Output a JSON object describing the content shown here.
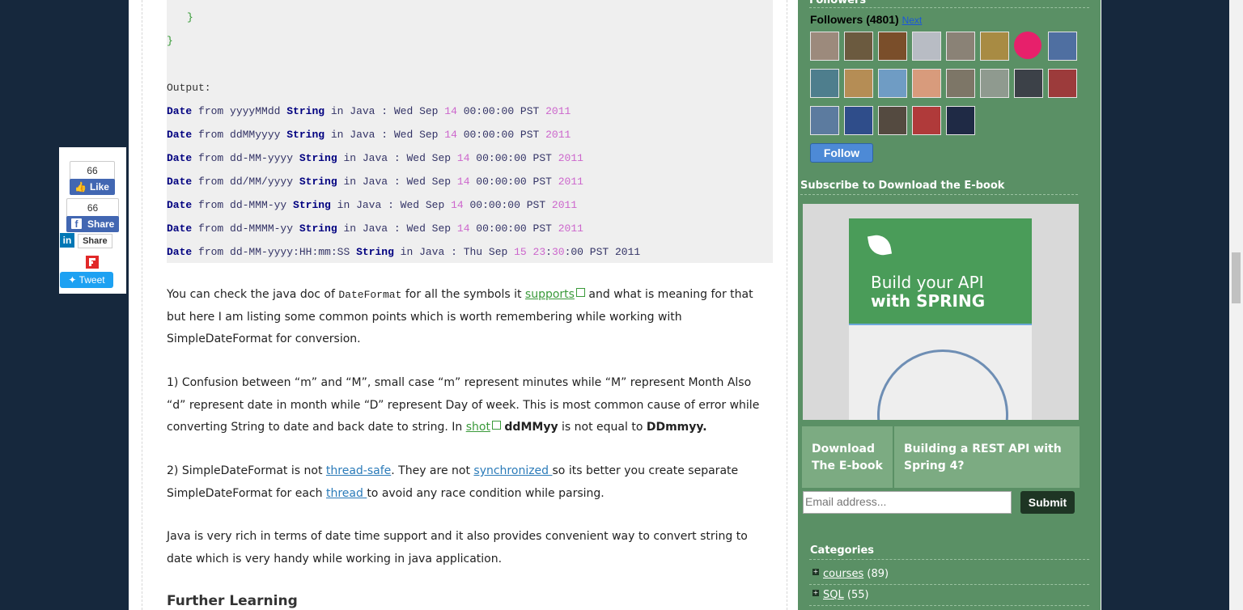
{
  "code": {
    "brace_inner": "}",
    "brace_outer": "}",
    "output_label": "Output:",
    "lines": [
      {
        "kw1": "Date",
        "t1": " from yyyyMMdd ",
        "kw2": "String",
        "t2": " in Java : Wed Sep ",
        "n1": "14",
        "t3": " 00:00:00 PST ",
        "n2": "2011",
        "t4": "",
        "n3": "",
        "t5": ""
      },
      {
        "kw1": "Date",
        "t1": " from ddMMyyyy ",
        "kw2": "String",
        "t2": " in Java : Wed Sep ",
        "n1": "14",
        "t3": " 00:00:00 PST ",
        "n2": "2011",
        "t4": "",
        "n3": "",
        "t5": ""
      },
      {
        "kw1": "Date",
        "t1": " from dd-MM-yyyy ",
        "kw2": "String",
        "t2": " in Java : Wed Sep ",
        "n1": "14",
        "t3": " 00:00:00 PST ",
        "n2": "2011",
        "t4": "",
        "n3": "",
        "t5": ""
      },
      {
        "kw1": "Date",
        "t1": " from dd/MM/yyyy ",
        "kw2": "String",
        "t2": " in Java : Wed Sep ",
        "n1": "14",
        "t3": " 00:00:00 PST ",
        "n2": "2011",
        "t4": "",
        "n3": "",
        "t5": ""
      },
      {
        "kw1": "Date",
        "t1": " from dd-MMM-yy ",
        "kw2": "String",
        "t2": " in Java : Wed Sep ",
        "n1": "14",
        "t3": " 00:00:00 PST ",
        "n2": "2011",
        "t4": "",
        "n3": "",
        "t5": ""
      },
      {
        "kw1": "Date",
        "t1": " from dd-MMMM-yy ",
        "kw2": "String",
        "t2": " in Java : Wed Sep ",
        "n1": "14",
        "t3": " 00:00:00 PST ",
        "n2": "2011",
        "t4": "",
        "n3": "",
        "t5": ""
      },
      {
        "kw1": "Date",
        "t1": " from dd-MM-yyyy:HH:mm:SS ",
        "kw2": "String",
        "t2": " in Java : Thu Sep ",
        "n1": "15",
        "t3": " ",
        "n2": "23",
        "t4": ":",
        "n3": "30",
        "t5": ":00 PST 2011"
      }
    ]
  },
  "article": {
    "p1_a": "You can check the java doc of ",
    "p1_code": "DateFormat",
    "p1_b": " for all the symbols it ",
    "p1_link": "supports",
    "p1_c": " and what is meaning for that but here I am listing some common points which is worth remembering while working with SimpleDateFormat for conversion.",
    "p2_a": "1) Confusion between “m” and “M”, small case “m” represent minutes while “M” represent Month Also “d” represent date in month while “D” represent Day of week. This is most common cause of error while converting String to date and back date to string. In ",
    "p2_link": "shot",
    "p2_b1": "ddMMyy",
    "p2_c": " is not equal to ",
    "p2_b2": "DDmmyy.",
    "p3_a": "2) SimpleDateFormat is not ",
    "p3_link1": "thread-safe",
    "p3_b": ". They are not ",
    "p3_link2": "synchronized ",
    "p3_c": "so its better you create separate SimpleDateFormat for each ",
    "p3_link3": "thread ",
    "p3_d": "to avoid any race condition while parsing.",
    "p4": "Java is very rich in terms of date time support and it also provides convenient way to convert string to date which is very handy while working in java application.",
    "further": "Further Learning"
  },
  "share": {
    "like_count": "66",
    "like_label": "Like",
    "share_count": "66",
    "share_label": "Share",
    "linkedin_label": "Share",
    "tweet_label": "Tweet"
  },
  "sidebar": {
    "followers_header_partial": "Followers",
    "followers_title": "Followers (4801)",
    "next_label": "Next",
    "follow_label": "Follow",
    "subscribe_header": "Subscribe to Download the E-book",
    "book_title_line1": "Build your API",
    "book_title_line2": "with SPRING",
    "tab1": "Download The E-book",
    "tab2": "Building a REST API with Spring 4?",
    "email_placeholder": "Email address...",
    "submit_label": "Submit",
    "categories_header": "Categories",
    "categories": [
      {
        "name": "courses",
        "count": "(89)"
      },
      {
        "name": "SQL",
        "count": "(55)"
      }
    ]
  },
  "colors": {
    "sidebar_bg": "#5a9065",
    "page_bg": "#16283d",
    "keyword": "#000080",
    "number": "#cc66cc",
    "link": "#2b7bb9"
  }
}
